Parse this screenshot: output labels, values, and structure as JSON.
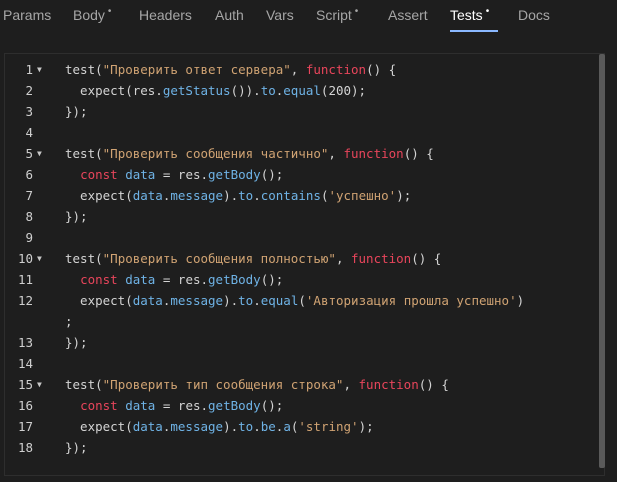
{
  "tabs": [
    {
      "label": "Params",
      "dot": ""
    },
    {
      "label": "Body",
      "dot": "•"
    },
    {
      "label": "Headers",
      "dot": ""
    },
    {
      "label": "Auth",
      "dot": ""
    },
    {
      "label": "Vars",
      "dot": ""
    },
    {
      "label": "Script",
      "dot": "•"
    },
    {
      "label": "Assert",
      "dot": ""
    },
    {
      "label": "Tests",
      "dot": "•"
    },
    {
      "label": "Docs",
      "dot": ""
    }
  ],
  "active_tab": "Tests",
  "colors": {
    "keyword": "#e8455b",
    "string": "#d0a373",
    "method": "#6fb3e6",
    "accent": "#8ab8ff"
  },
  "code_lines": [
    {
      "n": "1",
      "fold": "▼",
      "tokens": [
        [
          "p",
          "test("
        ],
        [
          "s",
          "\"Проверить ответ сервера\""
        ],
        [
          "p",
          ", "
        ],
        [
          "k",
          "function"
        ],
        [
          "p",
          "() {"
        ]
      ]
    },
    {
      "n": "2",
      "fold": "",
      "tokens": [
        [
          "p",
          "  expect(res."
        ],
        [
          "m",
          "getStatus"
        ],
        [
          "p",
          "())."
        ],
        [
          "m",
          "to"
        ],
        [
          "p",
          "."
        ],
        [
          "m",
          "equal"
        ],
        [
          "p",
          "(200);"
        ]
      ]
    },
    {
      "n": "3",
      "fold": "",
      "tokens": [
        [
          "p",
          "});"
        ]
      ]
    },
    {
      "n": "4",
      "fold": "",
      "tokens": []
    },
    {
      "n": "5",
      "fold": "▼",
      "tokens": [
        [
          "p",
          "test("
        ],
        [
          "s",
          "\"Проверить сообщения частично\""
        ],
        [
          "p",
          ", "
        ],
        [
          "k",
          "function"
        ],
        [
          "p",
          "() {"
        ]
      ]
    },
    {
      "n": "6",
      "fold": "",
      "tokens": [
        [
          "p",
          "  "
        ],
        [
          "k",
          "const"
        ],
        [
          "p",
          " "
        ],
        [
          "m",
          "data"
        ],
        [
          "p",
          " = res."
        ],
        [
          "m",
          "getBody"
        ],
        [
          "p",
          "();"
        ]
      ]
    },
    {
      "n": "7",
      "fold": "",
      "tokens": [
        [
          "p",
          "  expect("
        ],
        [
          "m",
          "data"
        ],
        [
          "p",
          "."
        ],
        [
          "m",
          "message"
        ],
        [
          "p",
          ")."
        ],
        [
          "m",
          "to"
        ],
        [
          "p",
          "."
        ],
        [
          "m",
          "contains"
        ],
        [
          "p",
          "("
        ],
        [
          "s",
          "'успешно'"
        ],
        [
          "p",
          ");"
        ]
      ]
    },
    {
      "n": "8",
      "fold": "",
      "tokens": [
        [
          "p",
          "});"
        ]
      ]
    },
    {
      "n": "9",
      "fold": "",
      "tokens": []
    },
    {
      "n": "10",
      "fold": "▼",
      "tokens": [
        [
          "p",
          "test("
        ],
        [
          "s",
          "\"Проверить сообщения полностью\""
        ],
        [
          "p",
          ", "
        ],
        [
          "k",
          "function"
        ],
        [
          "p",
          "() {"
        ]
      ]
    },
    {
      "n": "11",
      "fold": "",
      "tokens": [
        [
          "p",
          "  "
        ],
        [
          "k",
          "const"
        ],
        [
          "p",
          " "
        ],
        [
          "m",
          "data"
        ],
        [
          "p",
          " = res."
        ],
        [
          "m",
          "getBody"
        ],
        [
          "p",
          "();"
        ]
      ]
    },
    {
      "n": "12",
      "fold": "",
      "tokens": [
        [
          "p",
          "  expect("
        ],
        [
          "m",
          "data"
        ],
        [
          "p",
          "."
        ],
        [
          "m",
          "message"
        ],
        [
          "p",
          ")."
        ],
        [
          "m",
          "to"
        ],
        [
          "p",
          "."
        ],
        [
          "m",
          "equal"
        ],
        [
          "p",
          "("
        ],
        [
          "s",
          "'Авторизация прошла успешно'"
        ],
        [
          "p",
          ")"
        ]
      ]
    },
    {
      "n": "",
      "fold": "",
      "tokens": [
        [
          "p",
          ";"
        ]
      ]
    },
    {
      "n": "13",
      "fold": "",
      "tokens": [
        [
          "p",
          "});"
        ]
      ]
    },
    {
      "n": "14",
      "fold": "",
      "tokens": []
    },
    {
      "n": "15",
      "fold": "▼",
      "tokens": [
        [
          "p",
          "test("
        ],
        [
          "s",
          "\"Проверить тип сообщения строка\""
        ],
        [
          "p",
          ", "
        ],
        [
          "k",
          "function"
        ],
        [
          "p",
          "() {"
        ]
      ]
    },
    {
      "n": "16",
      "fold": "",
      "tokens": [
        [
          "p",
          "  "
        ],
        [
          "k",
          "const"
        ],
        [
          "p",
          " "
        ],
        [
          "m",
          "data"
        ],
        [
          "p",
          " = res."
        ],
        [
          "m",
          "getBody"
        ],
        [
          "p",
          "();"
        ]
      ]
    },
    {
      "n": "17",
      "fold": "",
      "tokens": [
        [
          "p",
          "  expect("
        ],
        [
          "m",
          "data"
        ],
        [
          "p",
          "."
        ],
        [
          "m",
          "message"
        ],
        [
          "p",
          ")."
        ],
        [
          "m",
          "to"
        ],
        [
          "p",
          "."
        ],
        [
          "m",
          "be"
        ],
        [
          "p",
          "."
        ],
        [
          "m",
          "a"
        ],
        [
          "p",
          "("
        ],
        [
          "s",
          "'string'"
        ],
        [
          "p",
          ");"
        ]
      ]
    },
    {
      "n": "18",
      "fold": "",
      "tokens": [
        [
          "p",
          "});"
        ]
      ]
    }
  ]
}
